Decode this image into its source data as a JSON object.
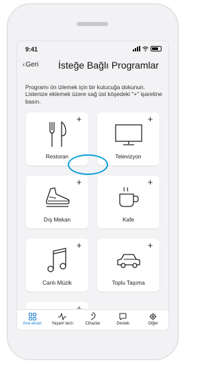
{
  "status": {
    "time": "9:41"
  },
  "nav": {
    "back_label": "Geri",
    "title": "İsteğe Bağlı Programlar"
  },
  "instructions": "Programı ön izlemek için bir kutucuğa dokunun. Listenize eklemek üzere sağ üst köşedeki \"+\" işaretine basın.",
  "programs": [
    {
      "label": "Restoran",
      "icon": "restaurant-icon"
    },
    {
      "label": "Televizyon",
      "icon": "tv-icon"
    },
    {
      "label": "Dış Mekan",
      "icon": "shoe-icon"
    },
    {
      "label": "Kafe",
      "icon": "cup-icon"
    },
    {
      "label": "Canlı Müzik",
      "icon": "music-note-icon"
    },
    {
      "label": "Toplu Taşıma",
      "icon": "car-icon"
    },
    {
      "label": "",
      "icon": ""
    }
  ],
  "add_symbol": "+",
  "tabs": [
    {
      "label": "Ana ekran",
      "icon": "grid-icon",
      "active": true
    },
    {
      "label": "Yaşam tarzı",
      "icon": "pulse-icon",
      "active": false
    },
    {
      "label": "Cihazlar",
      "icon": "hearing-aid-icon",
      "active": false
    },
    {
      "label": "Destek",
      "icon": "chat-bubble-icon",
      "active": false
    },
    {
      "label": "Diğer",
      "icon": "gear-icon",
      "active": false
    }
  ],
  "colors": {
    "accent": "#1a7fd0",
    "highlight": "#0fa0d6"
  }
}
